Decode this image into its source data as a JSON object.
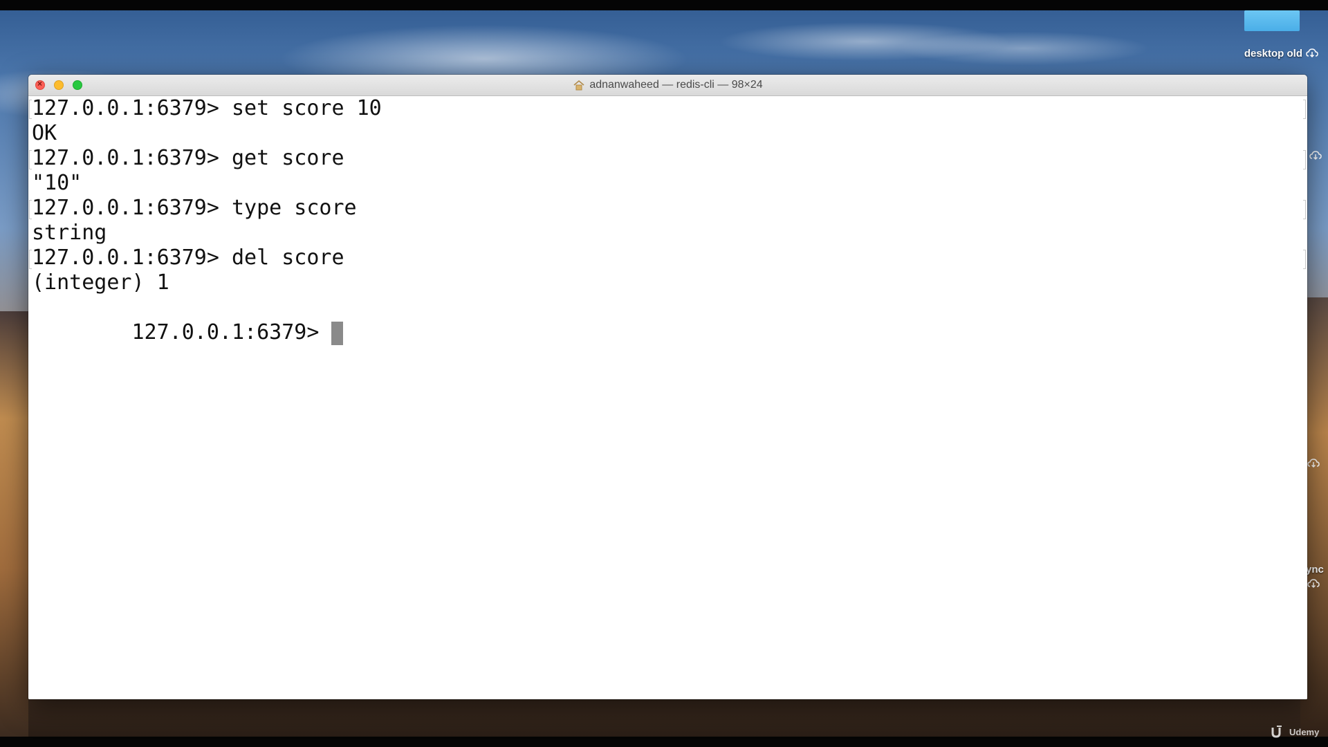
{
  "desktop": {
    "folder_label": "desktop old",
    "side_label": "ync"
  },
  "window": {
    "title": "adnanwaheed — redis-cli — 98×24"
  },
  "terminal": {
    "lines": [
      {
        "text": "127.0.0.1:6379> set score 10",
        "kind": "command"
      },
      {
        "text": "OK",
        "kind": "output"
      },
      {
        "text": "127.0.0.1:6379> get score",
        "kind": "command"
      },
      {
        "text": "\"10\"",
        "kind": "output"
      },
      {
        "text": "127.0.0.1:6379> type score",
        "kind": "command"
      },
      {
        "text": "string",
        "kind": "output"
      },
      {
        "text": "127.0.0.1:6379> del score",
        "kind": "command"
      },
      {
        "text": "(integer) 1",
        "kind": "output"
      },
      {
        "text": "127.0.0.1:6379>",
        "kind": "prompt"
      }
    ]
  },
  "watermark": {
    "label": "Udemy"
  },
  "colors": {
    "close": "#fc5f57",
    "minimize": "#fdbc2e",
    "maximize": "#28c840",
    "folder": "#4aaee8",
    "cursor": "#8a8a8a"
  }
}
